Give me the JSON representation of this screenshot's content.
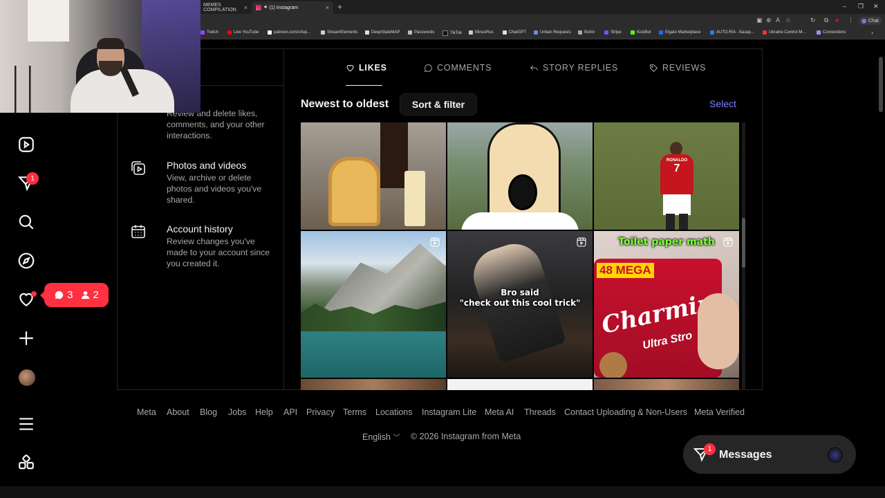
{
  "browser": {
    "tabs": [
      {
        "label": "MEMES COMPILATION",
        "active": false
      },
      {
        "label": "(1) Instagram",
        "active": true
      }
    ],
    "bookmarks": [
      "Twitch",
      "Live YouTube",
      "patreon.com/c/top...",
      "StreamElements",
      "DeepStateMAP",
      "Passwords",
      "TikTok",
      "MinusRus",
      "ChatGPT",
      "Unban Requests",
      "Botrix",
      "Stripe",
      "KickBot",
      "Elgato Marketplace",
      "AUTO.RIA - Базар...",
      "Ukraine Control M...",
      "Connections"
    ],
    "chat_label": "Chat"
  },
  "nav": {
    "activity_badge": "1",
    "popup": {
      "comments": "3",
      "follows": "2"
    }
  },
  "activity_menu": [
    {
      "title": "Interactions",
      "title_visible": "tions",
      "desc": "Review and delete likes, comments, and your other interactions."
    },
    {
      "title": "Photos and videos",
      "desc": "View, archive or delete photos and videos you've shared."
    },
    {
      "title": "Account history",
      "desc": "Review changes you've made to your account since you created it."
    }
  ],
  "tabs": [
    "LIKES",
    "COMMENTS",
    "STORY REPLIES",
    "REVIEWS"
  ],
  "active_tab": "LIKES",
  "sort": {
    "title": "Newest to oldest",
    "button": "Sort & filter",
    "select": "Select"
  },
  "grid": {
    "captions": {
      "cell5": "Bro said\n\"check out this cool trick\"",
      "cell6_title": "Toilet paper math",
      "cell6_mega": "48 MEGA",
      "cell6_brand": "Charmin",
      "cell6_sub": "Ultra Stro"
    },
    "player_name": "RONALDO",
    "player_number": "7"
  },
  "footer": {
    "links": [
      "Meta",
      "About",
      "Blog",
      "Jobs",
      "Help",
      "API",
      "Privacy",
      "Terms",
      "Locations",
      "Instagram Lite",
      "Meta AI",
      "Threads",
      "Contact Uploading & Non-Users",
      "Meta Verified"
    ],
    "language": "English",
    "copyright": "© 2026 Instagram from Meta"
  },
  "messages": {
    "label": "Messages",
    "badge": "1"
  },
  "colors": {
    "accent": "#7b80ff",
    "badge": "#ff3040",
    "bg": "#000000",
    "muted": "#a8a8a8"
  }
}
